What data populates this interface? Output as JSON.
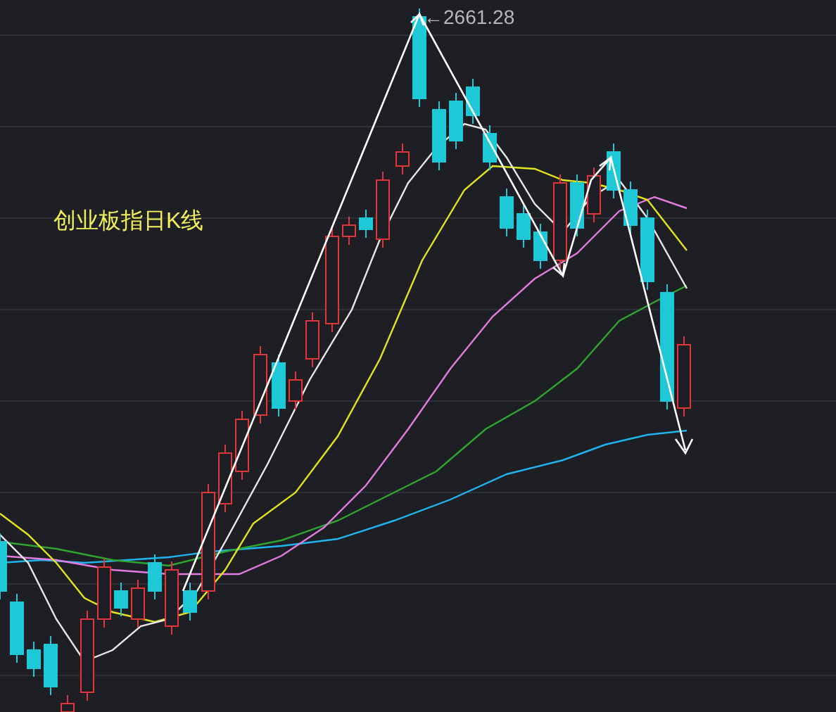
{
  "chart": {
    "title": "创业板指日K线",
    "peak_label": "←2661.28"
  }
}
